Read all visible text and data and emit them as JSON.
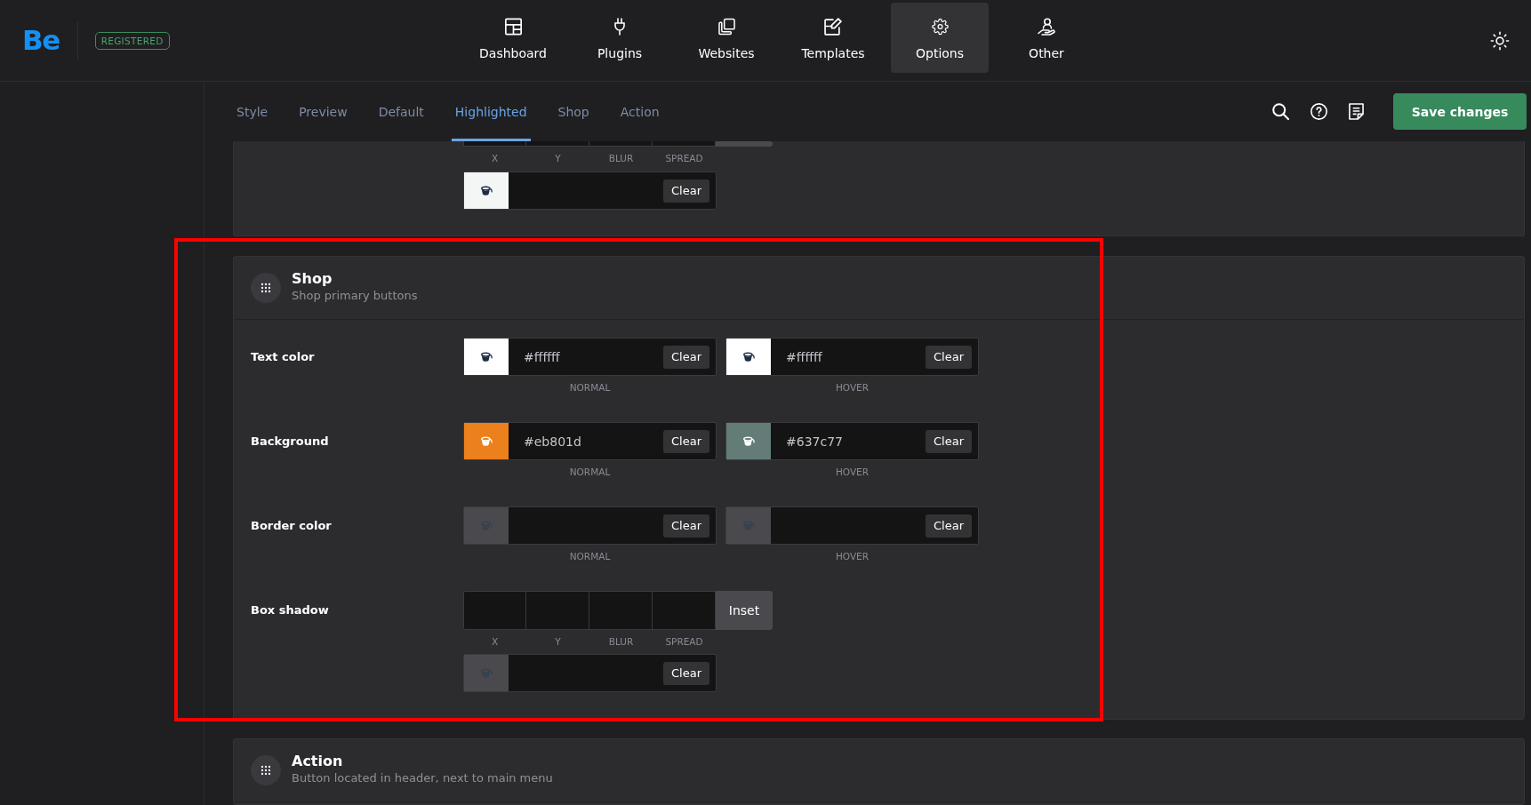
{
  "header": {
    "logo": "Be",
    "badge": "REGISTERED",
    "nav": [
      {
        "label": "Dashboard",
        "selected": false
      },
      {
        "label": "Plugins",
        "selected": false
      },
      {
        "label": "Websites",
        "selected": false
      },
      {
        "label": "Templates",
        "selected": false
      },
      {
        "label": "Options",
        "selected": true
      },
      {
        "label": "Other",
        "selected": false
      }
    ]
  },
  "toolbar": {
    "tabs": [
      {
        "label": "Style",
        "selected": false
      },
      {
        "label": "Preview",
        "selected": false
      },
      {
        "label": "Default",
        "selected": false
      },
      {
        "label": "Highlighted",
        "selected": true
      },
      {
        "label": "Shop",
        "selected": false
      },
      {
        "label": "Action",
        "selected": false
      }
    ],
    "save_button": "Save changes"
  },
  "sections": [
    {
      "outlined": false,
      "rows": [
        {
          "kind": "shadow-tail",
          "captions": [
            "X",
            "Y",
            "BLUR",
            "SPREAD"
          ],
          "color_field": {
            "color": "#f4f6f5",
            "clear": "Clear"
          }
        }
      ]
    },
    {
      "title": "Shop",
      "subtitle": "Shop primary buttons",
      "outlined": true,
      "rows": [
        {
          "kind": "color-pair",
          "label": "Text color",
          "fields": [
            {
              "value": "#ffffff",
              "color": "#ffffff",
              "clear": "Clear",
              "caption": "NORMAL"
            },
            {
              "value": "#ffffff",
              "color": "#ffffff",
              "clear": "Clear",
              "caption": "HOVER"
            }
          ]
        },
        {
          "kind": "color-pair",
          "label": "Background",
          "fields": [
            {
              "value": "#eb801d",
              "color": "#eb801d",
              "clear": "Clear",
              "caption": "NORMAL"
            },
            {
              "value": "#637c77",
              "color": "#637c77",
              "clear": "Clear",
              "caption": "HOVER"
            }
          ]
        },
        {
          "kind": "color-pair",
          "label": "Border color",
          "fields": [
            {
              "clear": "Clear",
              "caption": "NORMAL"
            },
            {
              "clear": "Clear",
              "caption": "HOVER"
            }
          ]
        },
        {
          "kind": "shadow",
          "label": "Box shadow",
          "captions": [
            "X",
            "Y",
            "BLUR",
            "SPREAD"
          ],
          "inset": "Inset",
          "color_field": {
            "clear": "Clear"
          }
        }
      ]
    },
    {
      "title": "Action",
      "subtitle": "Button located in header, next to main menu",
      "outlined": false
    }
  ]
}
